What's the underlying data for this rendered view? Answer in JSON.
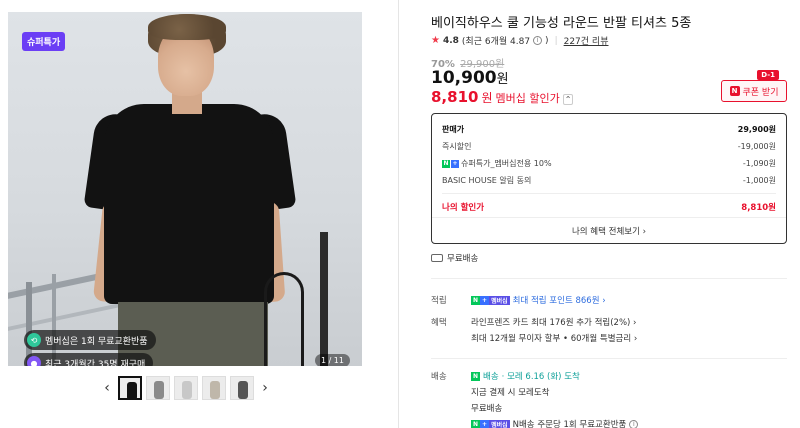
{
  "gallery": {
    "special_badge": "슈퍼특가",
    "overlay_badges": [
      {
        "text": "멤버십은 1회 무료교환반품",
        "icon": "exchange-icon"
      },
      {
        "text": "최근 3개월간 35명 재구매",
        "icon": "repurchase-icon"
      }
    ],
    "counter": "1 / 11",
    "prev_arrow": "‹",
    "next_arrow": "›"
  },
  "product": {
    "title": "베이직하우스 쿨 기능성 라운드 반팔 티셔츠 5종",
    "rating": "4.8",
    "rating_recent": "(최근 6개월 4.87",
    "rating_recent_close": ")",
    "review_count": "227건 리뷰",
    "discount_pct": "70%",
    "original_price": "29,900원",
    "price": "10,900",
    "price_unit": "원",
    "member_price": "8,810",
    "member_price_unit": "원",
    "member_price_label": "멤버십 할인가",
    "coupon_dday": "D-1",
    "coupon_button": "쿠폰 받기"
  },
  "price_box": {
    "rows": [
      {
        "label": "판매가",
        "value": "29,900원"
      },
      {
        "label": "즉시할인",
        "value": "-19,000원"
      },
      {
        "label": "슈퍼특가_멤버십전용 10%",
        "value": "-1,090원"
      },
      {
        "label": "BASIC HOUSE 알림 동의",
        "value": "-1,000원"
      }
    ],
    "my_price_label": "나의 할인가",
    "my_price_value": "8,810원",
    "all_benefits": "나의 혜택 전체보기 ›"
  },
  "shipping_free": "무료배송",
  "points": {
    "key": "적립",
    "text": "최대 적립 포인트 866원 ›"
  },
  "benefits": {
    "key": "혜택",
    "line1": "라인프렌즈 카드 최대 176원 추가 적립(2%) ›",
    "line2": "최대 12개월 무이자 할부 • 60개월 특별금리 ›"
  },
  "delivery": {
    "key": "배송",
    "line1_prefix": "배송",
    "line1": "· 모레 6.16 (화) 도착",
    "line2": "지금 결제 시 모레도착",
    "line3": "무료배송",
    "line4": "N배송 주문당 1회 무료교환반품"
  },
  "colors": {
    "accent_red": "#e8112d",
    "naver_green": "#03c75a",
    "naver_blue": "#3870ff",
    "special_purple": "#6b3ef5"
  }
}
